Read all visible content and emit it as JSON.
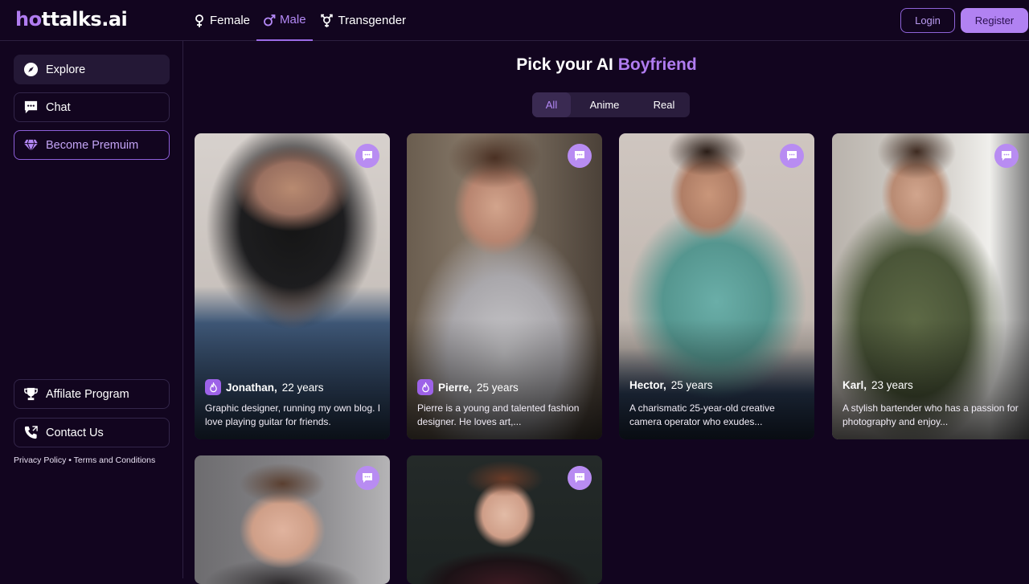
{
  "app": {
    "logo_text_pre": "h",
    "logo_text_o": "o",
    "logo_text_post": "ttalks.ai"
  },
  "nav": {
    "tabs": [
      {
        "label": "Female",
        "icon": "female-icon"
      },
      {
        "label": "Male",
        "icon": "male-icon",
        "active": true
      },
      {
        "label": "Transgender",
        "icon": "transgender-icon"
      }
    ],
    "login_label": "Login",
    "register_label": "Register"
  },
  "sidebar": {
    "items": [
      {
        "label": "Explore",
        "icon": "compass-icon"
      },
      {
        "label": "Chat",
        "icon": "chat-icon"
      },
      {
        "label": "Become Premuim",
        "icon": "diamond-icon"
      },
      {
        "label": "Affilate Program",
        "icon": "trophy-icon"
      },
      {
        "label": "Contact Us",
        "icon": "phone-icon"
      }
    ],
    "legal": "Privacy Policy • Terms and Conditions"
  },
  "main": {
    "title_prefix": "Pick your AI ",
    "title_accent": "Boyfriend",
    "filters": [
      "All",
      "Anime",
      "Real"
    ],
    "selected_filter": "All"
  },
  "cards": [
    {
      "name": "Jonathan,",
      "age": "22 years",
      "hot": true,
      "desc": "Graphic designer, running my own blog. I love playing guitar for friends."
    },
    {
      "name": "Pierre,",
      "age": "25 years",
      "hot": true,
      "desc": "Pierre is a young and talented fashion designer. He loves art,..."
    },
    {
      "name": "Hector,",
      "age": "25 years",
      "hot": false,
      "desc": "A charismatic 25-year-old creative camera operator who exudes..."
    },
    {
      "name": "Karl,",
      "age": "23 years",
      "hot": false,
      "desc": "A stylish bartender who has a passion for photography and enjoy..."
    },
    {
      "name": "",
      "age": "",
      "hot": false,
      "desc": ""
    },
    {
      "name": "",
      "age": "",
      "hot": false,
      "desc": ""
    }
  ],
  "colors": {
    "background": "#12051f",
    "accent": "#b07cf0",
    "register_bg": "#b182f2"
  }
}
